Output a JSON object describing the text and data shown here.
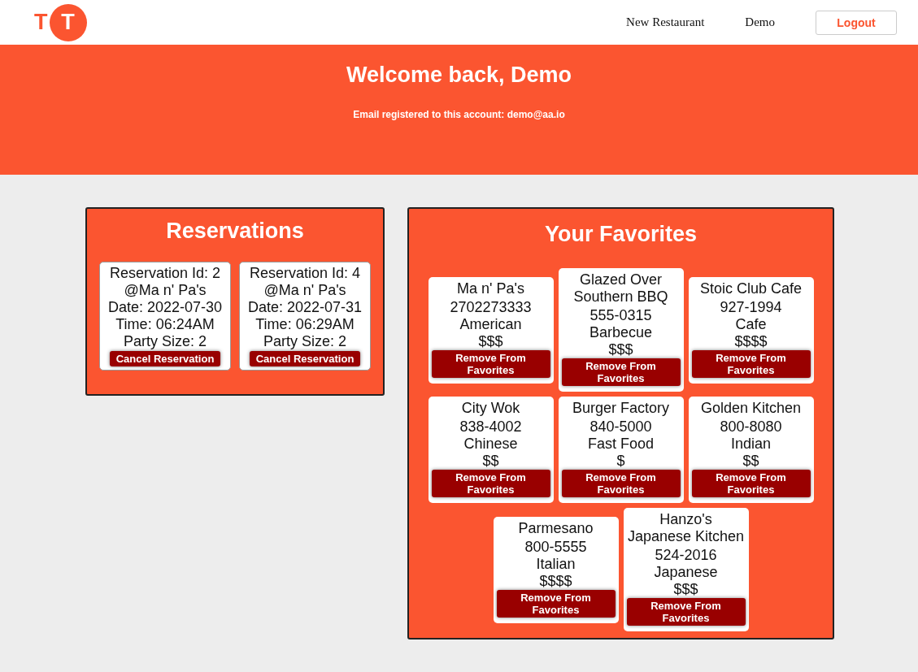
{
  "logo": {
    "letters": [
      "T",
      "T"
    ]
  },
  "nav": {
    "links": [
      "New Restaurant",
      "Demo"
    ],
    "logout": "Logout"
  },
  "banner": {
    "title": "Welcome back, Demo",
    "email_line": "Email registered to this account: demo@aa.io"
  },
  "reservations": {
    "title": "Reservations",
    "items": [
      {
        "lines": [
          "Reservation Id: 2",
          "@Ma n' Pa's",
          "Date: 2022-07-30",
          "Time: 06:24AM",
          "Party Size: 2"
        ],
        "button": "Cancel Reservation"
      },
      {
        "lines": [
          "Reservation Id: 4",
          "@Ma n' Pa's",
          "Date: 2022-07-31",
          "Time: 06:29AM",
          "Party Size: 2"
        ],
        "button": "Cancel Reservation"
      }
    ]
  },
  "favorites": {
    "title": "Your Favorites",
    "items": [
      {
        "name": "Ma n' Pa's",
        "phone": "2702273333",
        "cuisine": "American",
        "price": "$$$",
        "button": "Remove From Favorites"
      },
      {
        "name": "Glazed Over Southern BBQ",
        "phone": "555-0315",
        "cuisine": "Barbecue",
        "price": "$$$",
        "button": "Remove From Favorites"
      },
      {
        "name": "Stoic Club Cafe",
        "phone": "927-1994",
        "cuisine": "Cafe",
        "price": "$$$$",
        "button": "Remove From Favorites"
      },
      {
        "name": "City Wok",
        "phone": "838-4002",
        "cuisine": "Chinese",
        "price": "$$",
        "button": "Remove From Favorites"
      },
      {
        "name": "Burger Factory",
        "phone": "840-5000",
        "cuisine": "Fast Food",
        "price": "$",
        "button": "Remove From Favorites"
      },
      {
        "name": "Golden Kitchen",
        "phone": "800-8080",
        "cuisine": "Indian",
        "price": "$$",
        "button": "Remove From Favorites"
      },
      {
        "name": "Parmesano",
        "phone": "800-5555",
        "cuisine": "Italian",
        "price": "$$$$",
        "button": "Remove From Favorites"
      },
      {
        "name": "Hanzo's Japanese Kitchen",
        "phone": "524-2016",
        "cuisine": "Japanese",
        "price": "$$$",
        "button": "Remove From Favorites"
      }
    ]
  }
}
